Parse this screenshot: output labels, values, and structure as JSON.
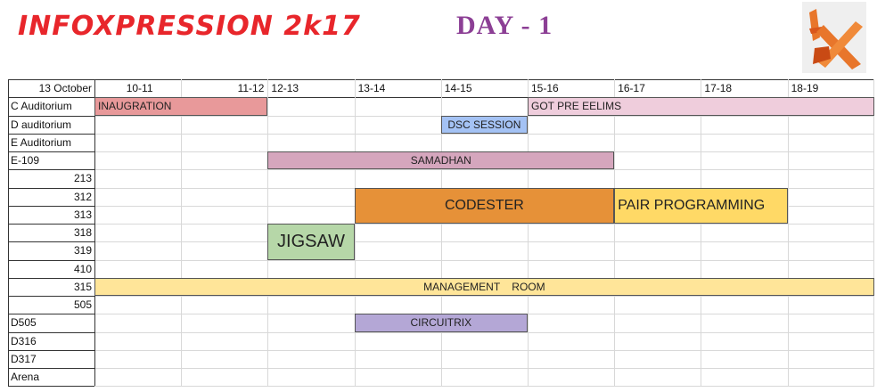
{
  "title": "INFOXPRESSION 2k17",
  "day": "DAY - 1",
  "logo": {
    "icon": "ix-logo-icon",
    "color": "#e8762b"
  },
  "date": "13 October",
  "slots": [
    "10-11",
    "11-12",
    "12-13",
    "13-14",
    "14-15",
    "15-16",
    "16-17",
    "17-18",
    "18-19"
  ],
  "rooms": [
    {
      "name": "C Auditorium",
      "align": "left"
    },
    {
      "name": "D auditorium",
      "align": "left"
    },
    {
      "name": "E Auditorium",
      "align": "left"
    },
    {
      "name": "E-109",
      "align": "left"
    },
    {
      "name": "213",
      "align": "right"
    },
    {
      "name": "312",
      "align": "right"
    },
    {
      "name": "313",
      "align": "right"
    },
    {
      "name": "318",
      "align": "right"
    },
    {
      "name": "319",
      "align": "right"
    },
    {
      "name": "410",
      "align": "right"
    },
    {
      "name": "315",
      "align": "right"
    },
    {
      "name": "505",
      "align": "right"
    },
    {
      "name": "D505",
      "align": "left"
    },
    {
      "name": "D316",
      "align": "left"
    },
    {
      "name": "D317",
      "align": "left"
    },
    {
      "name": "Arena",
      "align": "left"
    }
  ],
  "events": [
    {
      "name": "INAUGRATION",
      "row": 0,
      "rows": 1,
      "start": 0,
      "span": 2,
      "color": "#e8999a",
      "style": "left"
    },
    {
      "name": "GOT PRE EELIMS",
      "row": 0,
      "rows": 1,
      "start": 5,
      "span": 4,
      "color": "#efcddc",
      "style": "left"
    },
    {
      "name": "DSC SESSION",
      "row": 1,
      "rows": 1,
      "start": 4,
      "span": 1,
      "color": "#a4c2f4",
      "style": "center"
    },
    {
      "name": "SAMADHAN",
      "row": 3,
      "rows": 1,
      "start": 2,
      "span": 4,
      "color": "#d5a6bd",
      "style": "center"
    },
    {
      "name": "CODESTER",
      "row": 5,
      "rows": 2,
      "start": 3,
      "span": 3,
      "color": "#e69138",
      "style": "center-big"
    },
    {
      "name": "PAIR PROGRAMMING",
      "row": 5,
      "rows": 2,
      "start": 6,
      "span": 2,
      "color": "#ffd966",
      "style": "left-big"
    },
    {
      "name": "JIGSAW",
      "row": 7,
      "rows": 2,
      "start": 2,
      "span": 1,
      "color": "#b6d7a8",
      "style": "center-xbig"
    },
    {
      "name": "MANAGEMENT    ROOM",
      "row": 10,
      "rows": 1,
      "start": 0,
      "span": 9,
      "color": "#ffe599",
      "style": "center"
    },
    {
      "name": "CIRCUITRIX",
      "row": 12,
      "rows": 1,
      "start": 3,
      "span": 2,
      "color": "#b4a7d6",
      "style": "center"
    }
  ]
}
